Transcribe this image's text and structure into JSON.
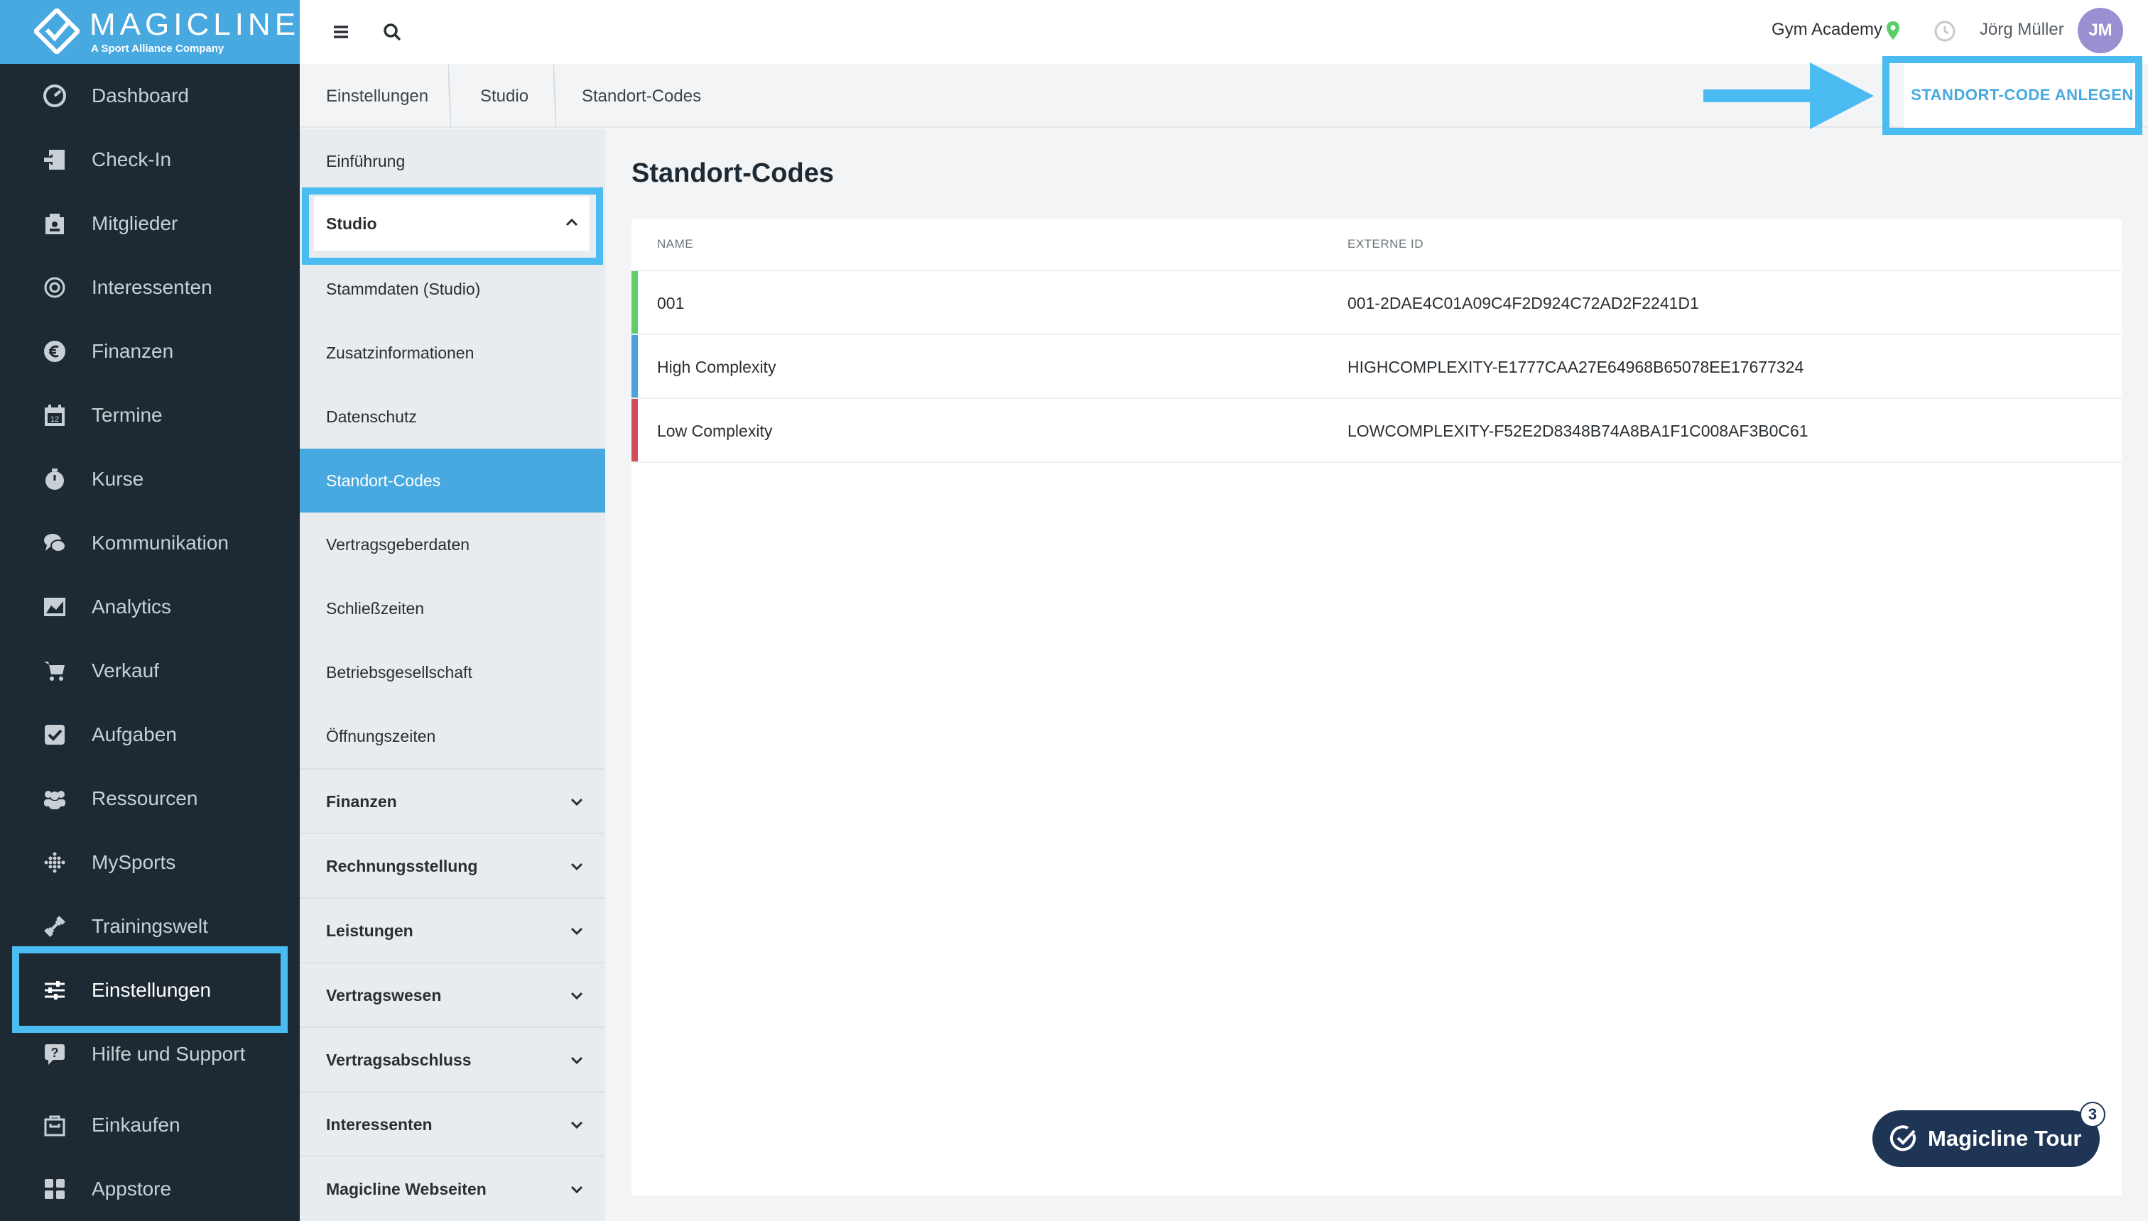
{
  "logo": {
    "wordmark": "MAGICLINE",
    "tagline": "A Sport Alliance Company"
  },
  "nav": {
    "items": [
      {
        "label": "Dashboard",
        "icon": "dashboard-icon"
      },
      {
        "label": "Check-In",
        "icon": "check-in-icon"
      },
      {
        "label": "Mitglieder",
        "icon": "members-icon"
      },
      {
        "label": "Interessenten",
        "icon": "prospects-icon"
      },
      {
        "label": "Finanzen",
        "icon": "euro-icon"
      },
      {
        "label": "Termine",
        "icon": "calendar-icon"
      },
      {
        "label": "Kurse",
        "icon": "stopwatch-icon"
      },
      {
        "label": "Kommunikation",
        "icon": "chat-icon"
      },
      {
        "label": "Analytics",
        "icon": "chart-icon"
      },
      {
        "label": "Verkauf",
        "icon": "cart-icon"
      },
      {
        "label": "Aufgaben",
        "icon": "checkbox-icon"
      },
      {
        "label": "Ressourcen",
        "icon": "group-icon"
      },
      {
        "label": "MySports",
        "icon": "dots-icon"
      },
      {
        "label": "Trainingswelt",
        "icon": "dumbbell-icon"
      },
      {
        "label": "Einstellungen",
        "icon": "sliders-icon"
      },
      {
        "label": "Hilfe und Support",
        "icon": "help-icon"
      },
      {
        "label": "Einkaufen",
        "icon": "shop-icon"
      },
      {
        "label": "Appstore",
        "icon": "grid-icon"
      }
    ],
    "active": "Einstellungen"
  },
  "topbar": {
    "studio": "Gym Academy",
    "user": "Jörg Müller",
    "avatar_initials": "JM",
    "accent": "#48a9e0"
  },
  "breadcrumb": [
    "Einstellungen",
    "Studio",
    "Standort-Codes"
  ],
  "actions": {
    "create_label": "STANDORT-CODE ANLEGEN"
  },
  "submenu": {
    "intro": "Einführung",
    "studio_group": "Studio",
    "studio_items": [
      "Stammdaten (Studio)",
      "Zusatzinformationen",
      "Datenschutz",
      "Standort-Codes",
      "Vertragsgeberdaten",
      "Schließzeiten",
      "Betriebsgesellschaft",
      "Öffnungszeiten"
    ],
    "active_item": "Standort-Codes",
    "groups": [
      "Finanzen",
      "Rechnungsstellung",
      "Leistungen",
      "Vertragswesen",
      "Vertragsabschluss",
      "Interessenten",
      "Magicline Webseiten"
    ]
  },
  "page": {
    "title": "Standort-Codes"
  },
  "table": {
    "headers": [
      "NAME",
      "EXTERNE ID"
    ],
    "rows": [
      {
        "name": "001",
        "external_id": "001-2DAE4C01A09C4F2D924C72AD2F2241D1",
        "color": "#5ccf6b"
      },
      {
        "name": "High Complexity",
        "external_id": "HIGHCOMPLEXITY-E1777CAA27E64968B65078EE17677324",
        "color": "#4aa3df"
      },
      {
        "name": "Low Complexity",
        "external_id": "LOWCOMPLEXITY-F52E2D8348B74A8BA1F1C008AF3B0C61",
        "color": "#d64a5a"
      }
    ]
  },
  "tour": {
    "label": "Magicline Tour",
    "badge": "3"
  }
}
